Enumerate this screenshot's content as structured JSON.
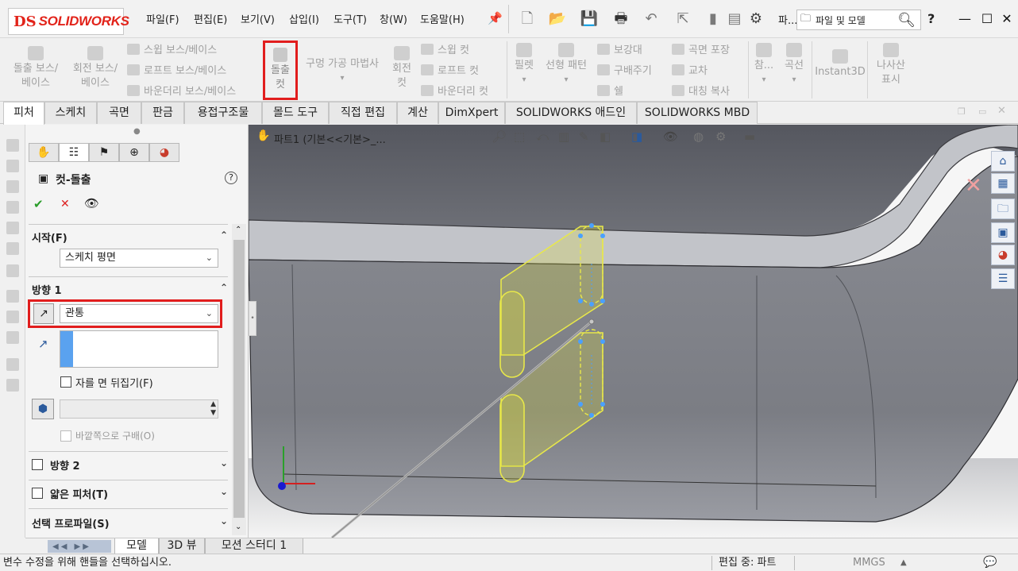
{
  "app": {
    "logo_prefix": "DS",
    "logo_text": "SOLIDWORKS"
  },
  "menu": [
    "파일(F)",
    "편집(E)",
    "보기(V)",
    "삽입(I)",
    "도구(T)",
    "창(W)",
    "도움말(H)"
  ],
  "search": {
    "label": "파...",
    "placeholder": "파일 및 모델"
  },
  "ribbon": {
    "extrude_boss": "돌출 보스/\n베이스",
    "revolve_boss": "회전 보스/\n베이스",
    "swept_boss": "스윕 보스/베이스",
    "lofted_boss": "로프트 보스/베이스",
    "boundary_boss": "바운더리 보스/베이스",
    "extruded_cut": "돌출\n컷",
    "hole_wizard": "구멍 가공 마법사",
    "revolved_cut": "회전\n컷",
    "swept_cut": "스윕 컷",
    "lofted_cut": "로프트 컷",
    "boundary_cut": "바운더리 컷",
    "fillet": "필렛",
    "linear_pattern": "선형 패턴",
    "rib": "보강대",
    "draft": "구배주기",
    "shell": "쉘",
    "wrap": "곡면 포장",
    "intersect": "교차",
    "mirror": "대칭 복사",
    "reference": "참...",
    "curves": "곡선",
    "instant3d": "Instant3D",
    "helix_display": "나사산\n표시"
  },
  "tabs": [
    "피처",
    "스케치",
    "곡면",
    "판금",
    "용접구조물",
    "몰드 도구",
    "직접 편집",
    "계산",
    "DimXpert",
    "SOLIDWORKS 애드인",
    "SOLIDWORKS MBD"
  ],
  "property_manager": {
    "title": "컷-돌출",
    "help": "?",
    "ok": "✔",
    "cancel": "✕",
    "preview": "👁",
    "from_header": "시작(F)",
    "from_value": "스케치 평면",
    "direction1_header": "방향 1",
    "end_condition": "관통",
    "flip_side_label": "자를 면 뒤집기(F)",
    "draft_outward_label": "바깥쪽으로 구배(O)",
    "direction2_header": "방향 2",
    "thin_feature_header": "얇은 피처(T)",
    "selected_contours_header": "선택 프로파일(S)"
  },
  "viewport": {
    "part_label": "파트1  (기본<<기본>_..."
  },
  "bottom_tabs": [
    "모델",
    "3D 뷰",
    "모션 스터디 1"
  ],
  "status": {
    "message": "변수 수정을 위해 핸들을 선택하십시오.",
    "mode": "편집 중: 파트",
    "units": "MMGS"
  },
  "colors": {
    "highlight": "#e11d1d",
    "logo": "#e2231a",
    "preview_yellow": "#e8e84a",
    "sketch_blue": "#4aa0ff"
  }
}
